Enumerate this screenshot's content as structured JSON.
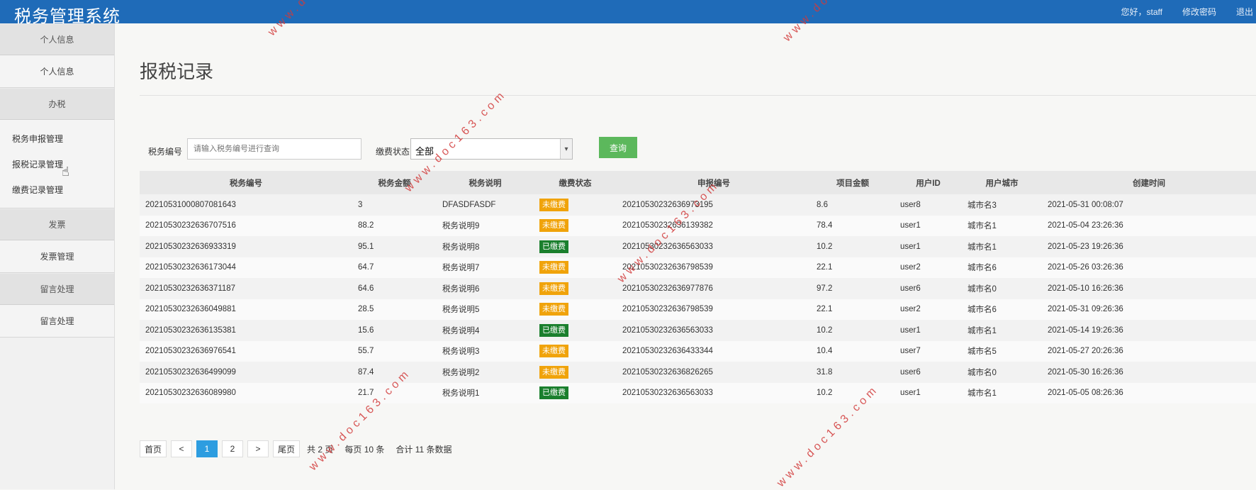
{
  "app": {
    "title": "税务管理系统",
    "greeting": "您好，staff",
    "change_password": "修改密码",
    "logout": "退出"
  },
  "sidebar": {
    "groups": [
      {
        "label": "个人信息",
        "items": [
          "个人信息"
        ]
      },
      {
        "label": "办税",
        "items": [
          "税务申报管理",
          "报税记录管理",
          "缴费记录管理"
        ]
      },
      {
        "label": "发票",
        "items": [
          "发票管理"
        ]
      },
      {
        "label": "留言处理",
        "items": [
          "留言处理"
        ]
      }
    ]
  },
  "page": {
    "title": "报税记录"
  },
  "filters": {
    "tax_no_label": "税务编号",
    "tax_no_placeholder": "请输入税务编号进行查询",
    "status_label": "缴费状态",
    "status_value": "全部",
    "query_button": "查询"
  },
  "table": {
    "columns": [
      "税务编号",
      "税务金额",
      "税务说明",
      "缴费状态",
      "申报编号",
      "项目金额",
      "用户ID",
      "用户城市",
      "创建时间"
    ],
    "rows": [
      [
        "20210531000807081643",
        "3",
        "DFASDFASDF",
        "未缴费",
        "20210530232636973195",
        "8.6",
        "user8",
        "城市名3",
        "2021-05-31 00:08:07"
      ],
      [
        "20210530232636707516",
        "88.2",
        "税务说明9",
        "未缴费",
        "20210530232636139382",
        "78.4",
        "user1",
        "城市名1",
        "2021-05-04 23:26:36"
      ],
      [
        "20210530232636933319",
        "95.1",
        "税务说明8",
        "已缴费",
        "20210530232636563033",
        "10.2",
        "user1",
        "城市名1",
        "2021-05-23 19:26:36"
      ],
      [
        "20210530232636173044",
        "64.7",
        "税务说明7",
        "未缴费",
        "20210530232636798539",
        "22.1",
        "user2",
        "城市名6",
        "2021-05-26 03:26:36"
      ],
      [
        "20210530232636371187",
        "64.6",
        "税务说明6",
        "未缴费",
        "20210530232636977876",
        "97.2",
        "user6",
        "城市名0",
        "2021-05-10 16:26:36"
      ],
      [
        "20210530232636049881",
        "28.5",
        "税务说明5",
        "未缴费",
        "20210530232636798539",
        "22.1",
        "user2",
        "城市名6",
        "2021-05-31 09:26:36"
      ],
      [
        "20210530232636135381",
        "15.6",
        "税务说明4",
        "已缴费",
        "20210530232636563033",
        "10.2",
        "user1",
        "城市名1",
        "2021-05-14 19:26:36"
      ],
      [
        "20210530232636976541",
        "55.7",
        "税务说明3",
        "未缴费",
        "20210530232636433344",
        "10.4",
        "user7",
        "城市名5",
        "2021-05-27 20:26:36"
      ],
      [
        "20210530232636499099",
        "87.4",
        "税务说明2",
        "未缴费",
        "20210530232636826265",
        "31.8",
        "user6",
        "城市名0",
        "2021-05-30 16:26:36"
      ],
      [
        "20210530232636089980",
        "21.7",
        "税务说明1",
        "已缴费",
        "20210530232636563033",
        "10.2",
        "user1",
        "城市名1",
        "2021-05-05 08:26:36"
      ]
    ]
  },
  "pagination": {
    "first": "首页",
    "prev": "<",
    "pages": [
      "1",
      "2"
    ],
    "current": "1",
    "next": ">",
    "last": "尾页",
    "total_pages": "共 2 页",
    "per_page": "每页 10 条",
    "total_records": "合计 11 条数据"
  },
  "watermark": "www.doc163.com",
  "colors": {
    "header": "#1f6bb8",
    "query_button": "#5cb85c",
    "unpaid_badge": "#f0a30a",
    "paid_badge": "#1a7f2d",
    "active_page": "#2d9de0",
    "watermark": "#d23a3a"
  },
  "icons": {
    "cursor": "hand-pointer-icon",
    "select_arrow": "chevron-down-icon"
  }
}
